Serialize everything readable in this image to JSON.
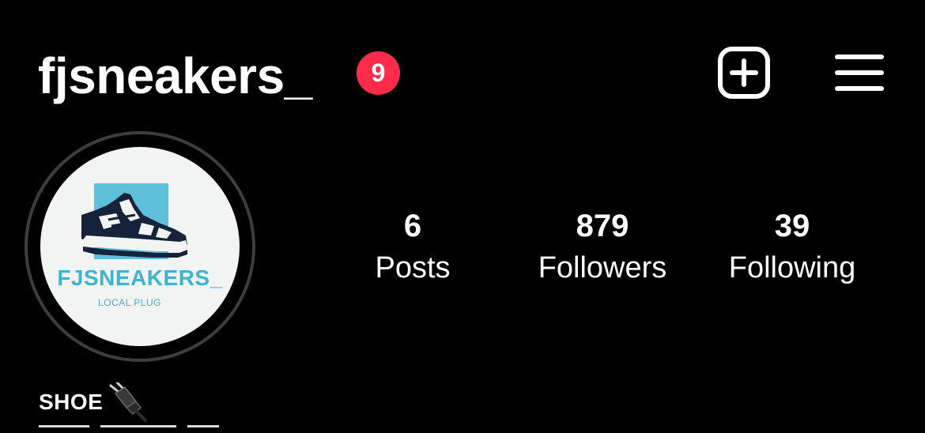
{
  "header": {
    "username": "fjsneakers_",
    "notification_count": "9",
    "new_post_icon": "plus-square-icon",
    "menu_icon": "hamburger-menu-icon"
  },
  "profile": {
    "avatar": {
      "logo_title": "FJSNEAKERS_",
      "logo_subtitle": "LOCAL PLUG",
      "logo_icon": "sneaker-icon"
    },
    "stats": [
      {
        "count": "6",
        "label": "Posts"
      },
      {
        "count": "879",
        "label": "Followers"
      },
      {
        "count": "39",
        "label": "Following"
      }
    ],
    "bio": {
      "name": "SHOE",
      "emoji_icon": "electric-plug-icon"
    }
  },
  "colors": {
    "background": "#000000",
    "text": "#ffffff",
    "badge": "#ff2b4a",
    "logo_accent": "#3fb3d6",
    "avatar_ring": "#3d3d3d"
  }
}
